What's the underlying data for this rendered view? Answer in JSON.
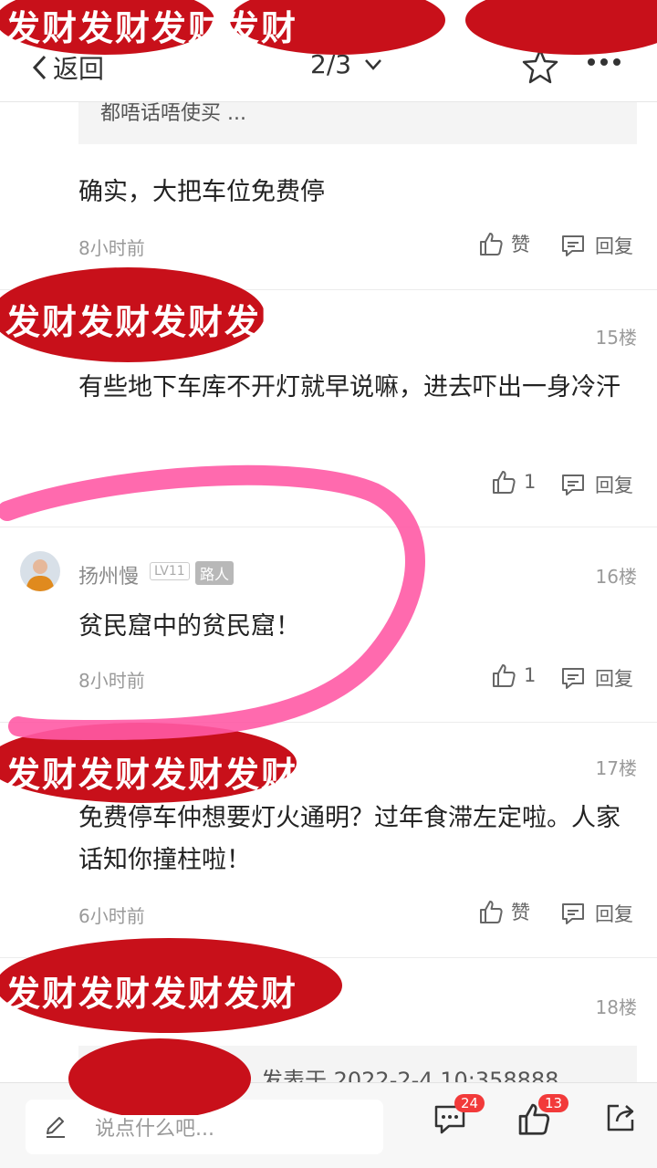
{
  "header": {
    "back_label": "返回",
    "page_indicator": "2/3"
  },
  "quoted_preview": "都唔话唔使买 ...",
  "comments": [
    {
      "content": "确实，大把车位免费停",
      "time": "8小时前",
      "like_label": "赞",
      "reply_label": "回复"
    },
    {
      "floor": "15楼",
      "content": "有些地下车库不开灯就早说嘛，进去吓出一身冷汗",
      "like_count": "1",
      "reply_label": "回复"
    },
    {
      "username": "扬州慢",
      "level": "LV11",
      "role": "路人",
      "floor": "16楼",
      "content": "贫民窟中的贫民窟！",
      "time": "8小时前",
      "like_count": "1",
      "reply_label": "回复"
    },
    {
      "floor": "17楼",
      "content": "免费停车仲想要灯火通明？过年食滞左定啦。人家话知你撞柱啦！",
      "time": "6小时前",
      "like_label": "赞",
      "reply_label": "回复"
    },
    {
      "floor": "18楼",
      "quote": "发表于 2022-2-4 10:358888"
    }
  ],
  "sticker_text": "发财发财发财发财",
  "footer": {
    "input_placeholder": "说点什么吧...",
    "comment_count": "24",
    "like_count": "13"
  },
  "colors": {
    "accent_red": "#f23a3a",
    "sticker_red": "#c8101a",
    "annotation_pink": "#ff5aa5"
  }
}
